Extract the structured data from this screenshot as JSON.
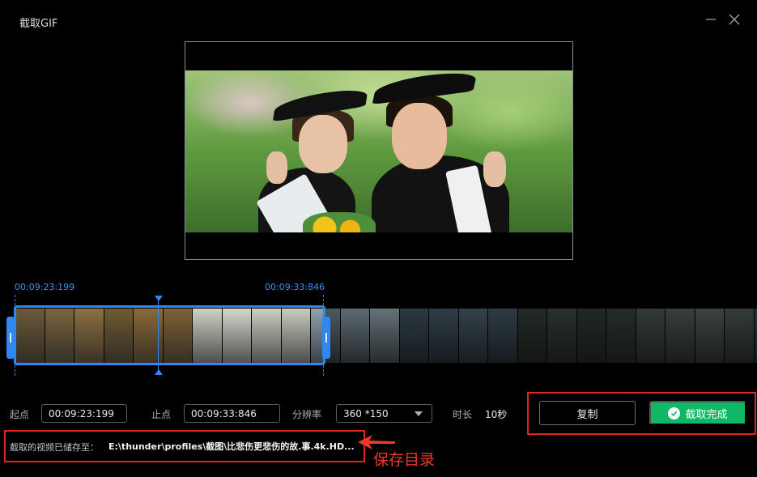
{
  "window": {
    "title": "截取GIF"
  },
  "icons": {
    "minimize": "minimize-icon",
    "close": "close-icon",
    "check": "check-circle-icon"
  },
  "timeline": {
    "start_timecode": "00:09:23:199",
    "end_timecode": "00:09:33:846",
    "frame_palette": [
      "#6b5a3a",
      "#7a6540",
      "#8c7042",
      "#6f5a33",
      "#8a6a3a",
      "#7d6238",
      "#cfd2c6",
      "#d6d8cf",
      "#cdd0c5",
      "#c9ccbf",
      "#8fa3b0",
      "#a9c4cf",
      "#b7d1db",
      "#4e6a7a",
      "#557082",
      "#5d7888",
      "#526d7d",
      "#3e4d44",
      "#485a50",
      "#3b4a42",
      "#41524a",
      "#5a6a64",
      "#63726c",
      "#6c7a74",
      "#5e6e68",
      "#4f5f59",
      "#2d3a33"
    ]
  },
  "controls": {
    "start_label": "起点",
    "start_value": "00:09:23:199",
    "end_label": "止点",
    "end_value": "00:09:33:846",
    "resolution_label": "分辨率",
    "resolution_value": "360 *150",
    "duration_label": "时长",
    "duration_value": "10秒",
    "copy_button": "复制",
    "done_button": "截取完成"
  },
  "save": {
    "label": "截取的视频已储存至：",
    "path": "E:\\thunder\\profiles\\截图\\比悲伤更悲伤的故.事.4k.HD..."
  },
  "annotation": {
    "text": "保存目录"
  },
  "colors": {
    "accent_blue": "#2f87f1",
    "done_green": "#10b765",
    "annotation_red": "#e0241c"
  }
}
